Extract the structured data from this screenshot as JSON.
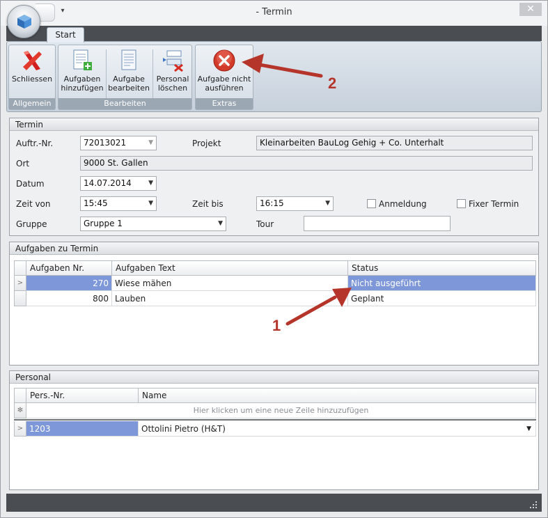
{
  "window": {
    "title": "- Termin",
    "qat_dropdown": "▾",
    "close": "✕"
  },
  "ribbon": {
    "tab": "Start",
    "groups": [
      {
        "label": "Allgemein",
        "buttons": [
          {
            "label": "Schliessen",
            "icon": "red-x-icon"
          }
        ]
      },
      {
        "label": "Bearbeiten",
        "buttons": [
          {
            "label_line1": "Aufgaben",
            "label_line2": "hinzufügen",
            "icon": "add-document-icon"
          },
          {
            "label_line1": "Aufgabe",
            "label_line2": "bearbeiten",
            "icon": "edit-document-icon"
          },
          {
            "label_line1": "Personal",
            "label_line2": "löschen",
            "icon": "delete-person-icon"
          }
        ]
      },
      {
        "label": "Extras",
        "buttons": [
          {
            "label_line1": "Aufgabe nicht",
            "label_line2": "ausführen",
            "icon": "red-cancel-circle-icon"
          }
        ]
      }
    ]
  },
  "termin": {
    "header": "Termin",
    "auftr_label": "Auftr.-Nr.",
    "auftr_value": "72013021",
    "projekt_label": "Projekt",
    "projekt_value": "Kleinarbeiten BauLog Gehig + Co. Unterhalt",
    "ort_label": "Ort",
    "ort_value": "9000 St. Gallen",
    "datum_label": "Datum",
    "datum_value": "14.07.2014",
    "zeit_von_label": "Zeit von",
    "zeit_von_value": "15:45",
    "zeit_bis_label": "Zeit bis",
    "zeit_bis_value": "16:15",
    "anmeldung_label": "Anmeldung",
    "fixer_label": "Fixer Termin",
    "gruppe_label": "Gruppe",
    "gruppe_value": "Gruppe 1",
    "tour_label": "Tour",
    "tour_value": ""
  },
  "aufgaben": {
    "header": "Aufgaben zu Termin",
    "columns": [
      "Aufgaben Nr.",
      "Aufgaben Text",
      "Status"
    ],
    "rows": [
      {
        "nr": "270",
        "text": "Wiese mähen",
        "status": "Nicht ausgeführt",
        "indicator": ">"
      },
      {
        "nr": "800",
        "text": "Lauben",
        "status": "Geplant",
        "indicator": ""
      }
    ]
  },
  "personal": {
    "header": "Personal",
    "columns": [
      "Pers.-Nr.",
      "Name"
    ],
    "new_row_hint": "Hier klicken um eine neue Zeile hinzuzufügen",
    "new_row_indicator": "✻",
    "rows": [
      {
        "nr": "1203",
        "name": "Ottolini Pietro (H&T)",
        "indicator": ">"
      }
    ]
  },
  "annotations": {
    "one": "1",
    "two": "2",
    "color": "#b5352a"
  }
}
